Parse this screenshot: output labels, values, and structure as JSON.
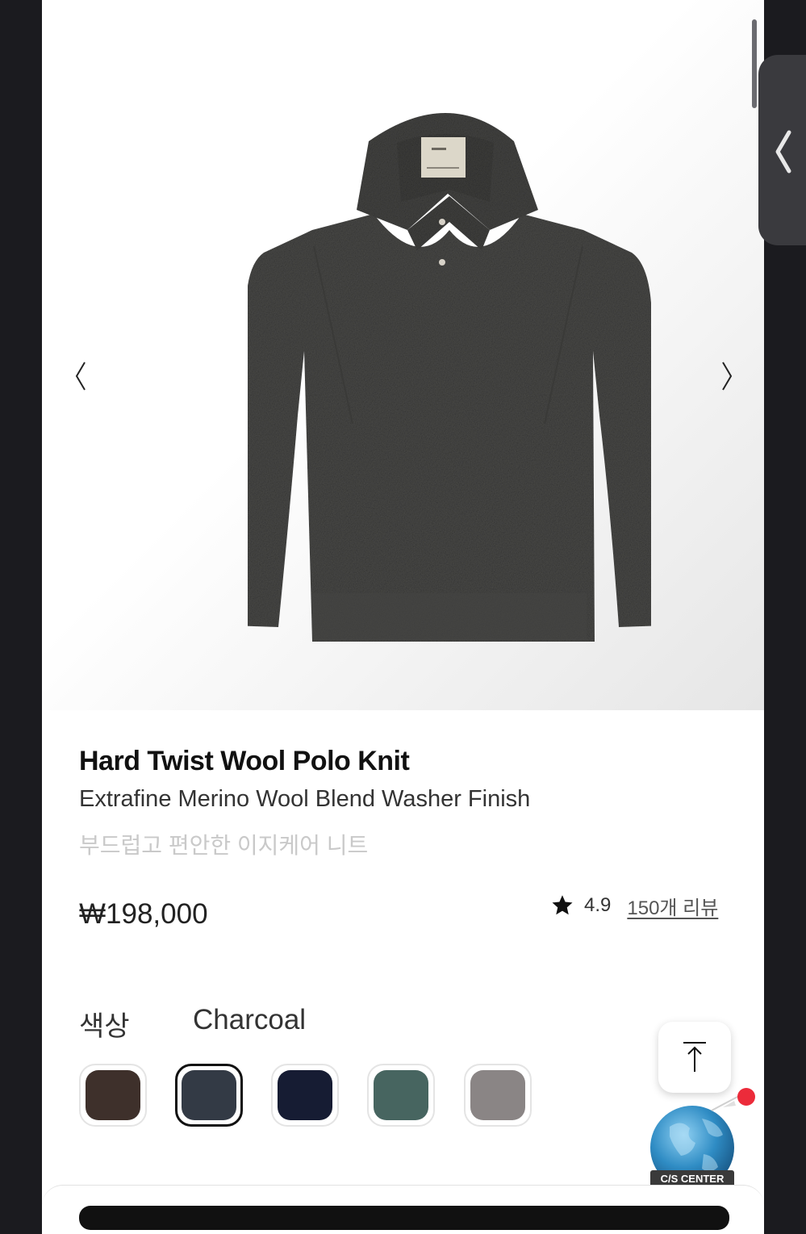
{
  "gallery": {
    "prev_label": "previous image",
    "next_label": "next image"
  },
  "product": {
    "name": "Hard Twist Wool Polo Knit",
    "subtitle": "Extrafine Merino Wool Blend Washer Finish",
    "description": "부드럽고 편안한 이지케어 니트",
    "price": "₩198,000",
    "rating": "4.9",
    "reviews": "150개 리뷰"
  },
  "color_selector": {
    "label": "색상",
    "selected": "Charcoal",
    "swatches": [
      {
        "color": "#3e302b"
      },
      {
        "color": "#333a45",
        "selected": true
      },
      {
        "color": "#161c33"
      },
      {
        "color": "#476560"
      },
      {
        "color": "#8a8585"
      }
    ]
  },
  "floating": {
    "cs_center_label": "C/S CENTER"
  },
  "colors": {
    "sweater": "#4a4a48",
    "badge": "#ec2b3a",
    "frame": "#1b1b1f"
  }
}
